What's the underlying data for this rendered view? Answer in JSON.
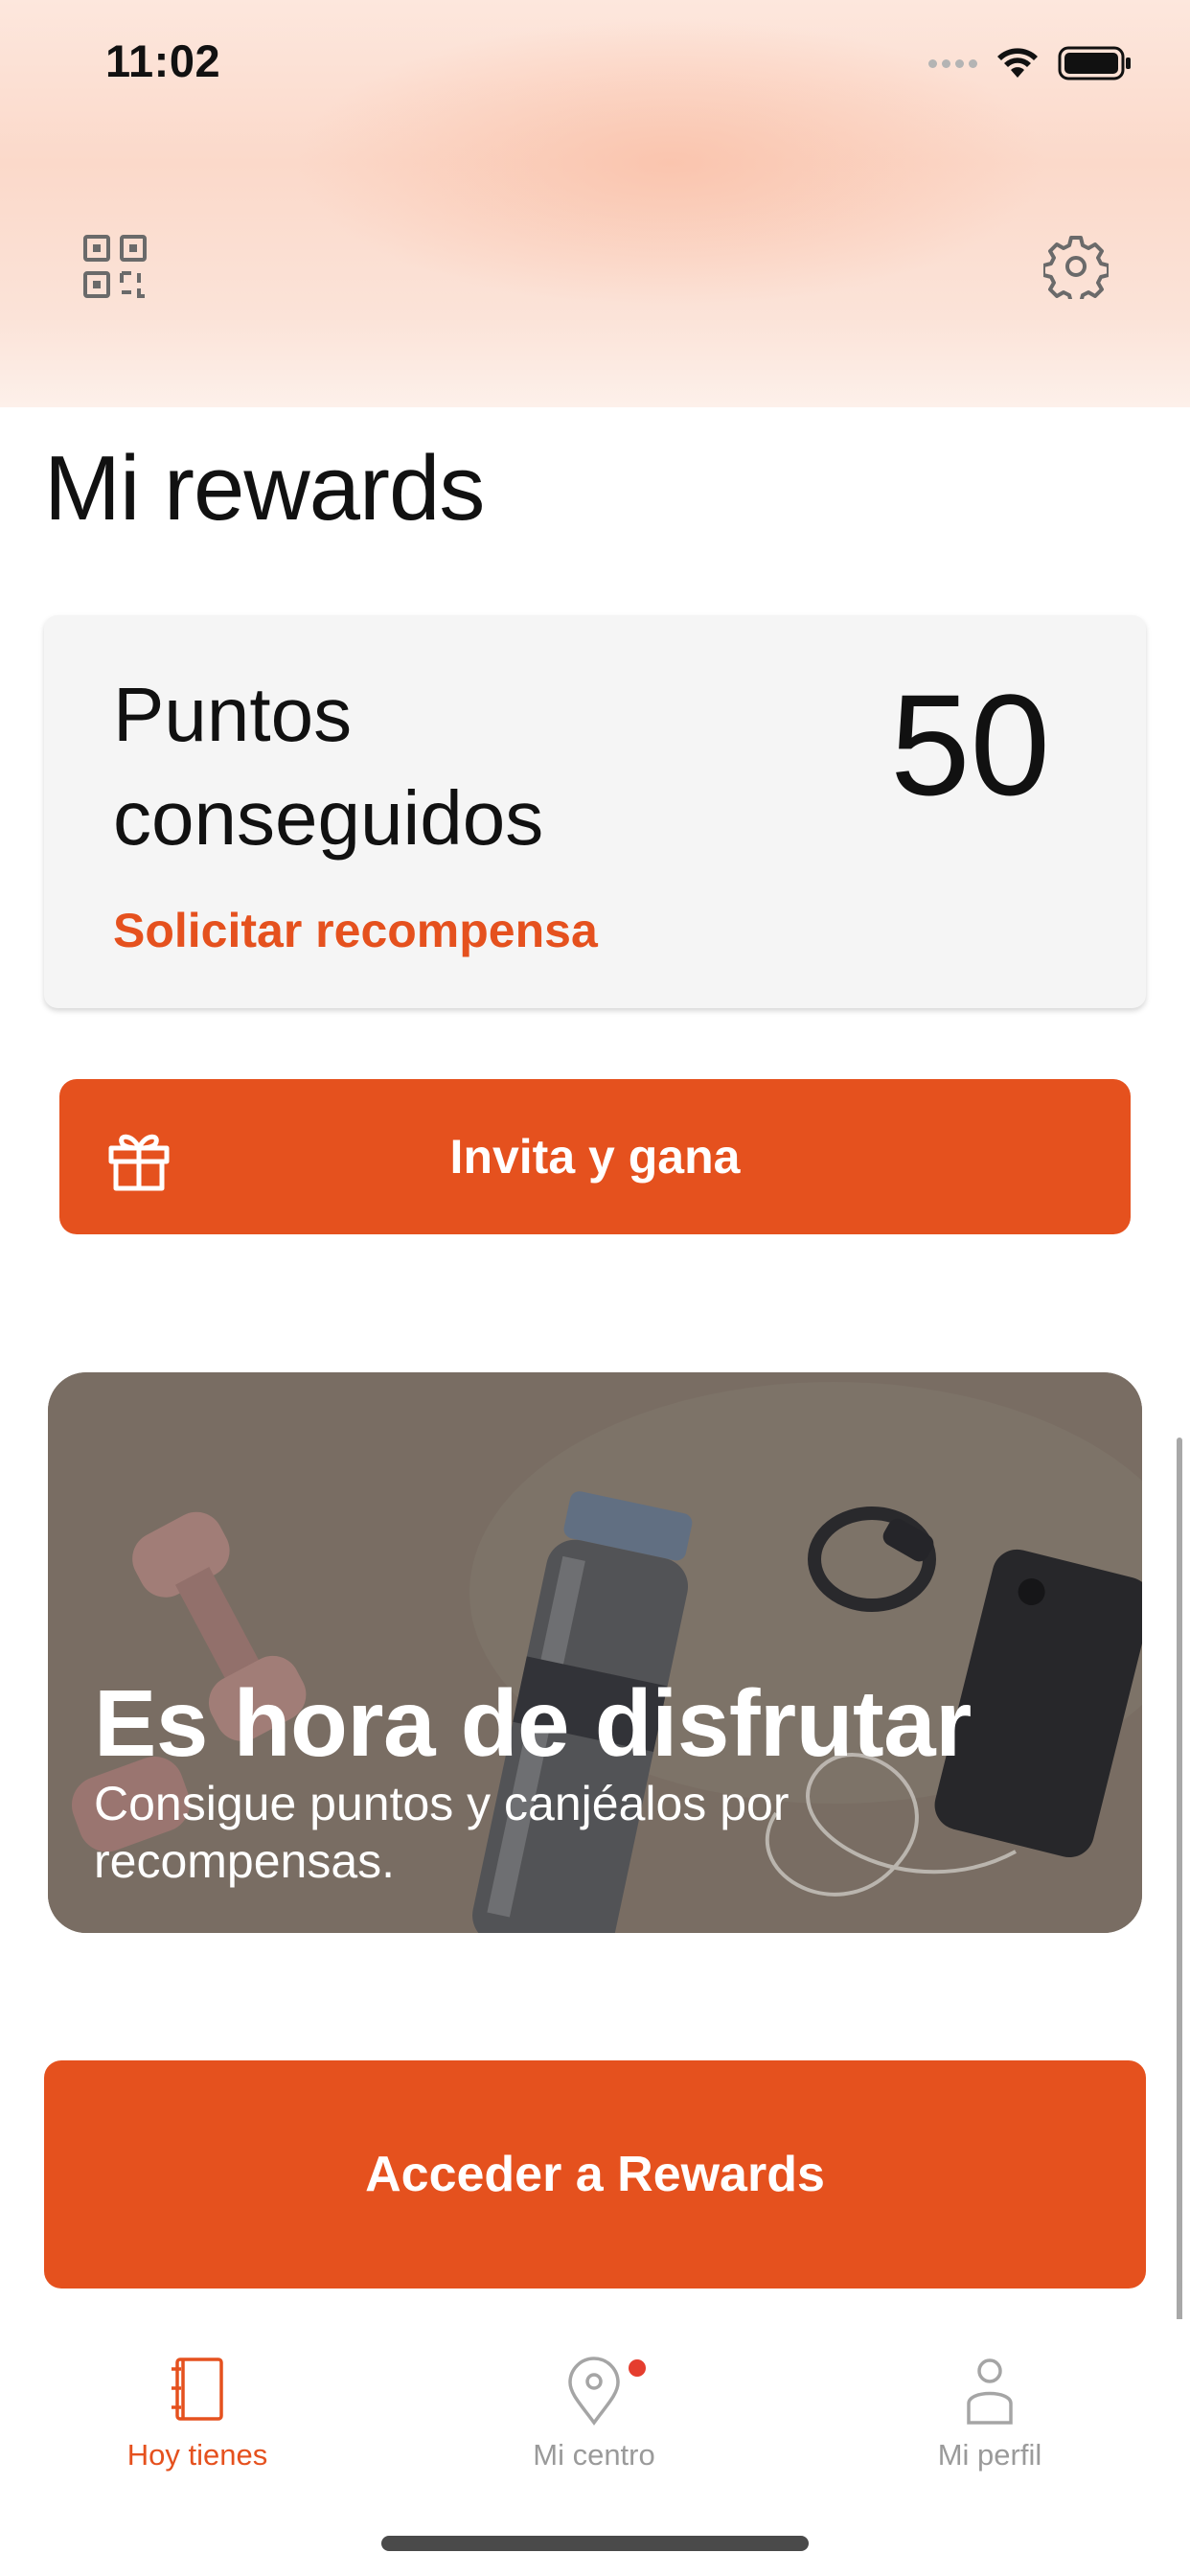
{
  "status_bar": {
    "time": "11:02"
  },
  "header": {
    "qr_icon": "qr-code-icon",
    "settings_icon": "gear-icon"
  },
  "page": {
    "title": "Mi rewards"
  },
  "points_card": {
    "label": "Puntos conseguidos",
    "value": "50",
    "link": "Solicitar recompensa"
  },
  "invite": {
    "label": "Invita y gana",
    "icon": "gift-icon"
  },
  "promo": {
    "title": "Es hora de disfrutar",
    "subtitle": "Consigue puntos y canjéalos por recompensas."
  },
  "cta": {
    "label": "Acceder a Rewards"
  },
  "tabbar": {
    "items": [
      {
        "label": "Hoy tienes",
        "icon": "notebook-icon",
        "active": true
      },
      {
        "label": "Mi centro",
        "icon": "location-pin-icon",
        "active": false,
        "badge": true
      },
      {
        "label": "Mi perfil",
        "icon": "person-icon",
        "active": false
      }
    ]
  },
  "colors": {
    "accent": "#e5511e",
    "inactive": "#9a9a9a"
  }
}
